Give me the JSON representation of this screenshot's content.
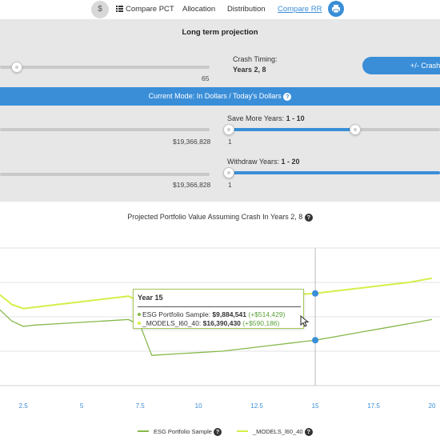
{
  "nav": {
    "dollar_icon": "$",
    "compare_pct": "Compare PCT",
    "allocation": "Allocation",
    "distribution": "Distribution",
    "compare_rr": "Compare RR"
  },
  "projection": {
    "title": "Long term projection",
    "slider_max_label": "65",
    "crash_timing_label": "Crash Timing:",
    "crash_timing_value": "Years 2, 8",
    "crash_button": "+/- Crash",
    "mode_text": "Current Mode: In Dollars / Today's Dollars",
    "save_more_label": "Save More Years:",
    "save_more_value": "1 - 10",
    "save_value": "$19,366,828",
    "save_min": "1",
    "withdraw_label": "Withdraw Years:",
    "withdraw_value": "1 - 20",
    "withdraw_amount": "$19,366,828",
    "withdraw_min": "1"
  },
  "colors": {
    "accent": "#3a8ed8",
    "series_esg": "#86b84a",
    "series_models": "#d6ee4a"
  },
  "chart_data": {
    "type": "line",
    "title": "Projected Portfolio Value Assuming Crash In Years 2, 8",
    "x_ticks": [
      "2.5",
      "5",
      "7.5",
      "10",
      "12.5",
      "15",
      "17.5",
      "20"
    ],
    "xlim": [
      1.5,
      20
    ],
    "ylim": [
      0,
      1
    ],
    "y_scale_note": "no y-axis labels visible",
    "crosshair_x": 15,
    "series": [
      {
        "name": "ESG Portfolio Sample",
        "x": [
          1.5,
          2,
          2.5,
          3,
          4,
          5,
          6,
          7,
          7.5,
          8,
          9,
          10,
          11,
          12,
          13,
          14,
          15,
          16,
          17,
          18,
          19,
          20
        ],
        "y": [
          0.55,
          0.47,
          0.43,
          0.44,
          0.45,
          0.46,
          0.47,
          0.48,
          0.44,
          0.22,
          0.23,
          0.24,
          0.25,
          0.27,
          0.29,
          0.31,
          0.33,
          0.36,
          0.39,
          0.42,
          0.45,
          0.48
        ]
      },
      {
        "name": "_MODELS_l60_40",
        "x": [
          1.5,
          2,
          2.5,
          3,
          4,
          5,
          6,
          7,
          7.5,
          8,
          9,
          10,
          11,
          12,
          13,
          14,
          15,
          16,
          17,
          18,
          19,
          20
        ],
        "y": [
          0.66,
          0.59,
          0.56,
          0.57,
          0.59,
          0.61,
          0.63,
          0.65,
          0.61,
          0.58,
          0.6,
          0.62,
          0.63,
          0.64,
          0.65,
          0.66,
          0.67,
          0.69,
          0.71,
          0.73,
          0.75,
          0.78
        ]
      }
    ],
    "tooltip": {
      "title": "Year 15",
      "esg_name": "ESG Portfolio Sample:",
      "esg_value": "$9,884,541",
      "esg_change": "(+$514,429)",
      "models_name": "_MODELS_l60_40:",
      "models_value": "$16,390,430",
      "models_change": "(+$590,186)"
    },
    "legend": {
      "esg": "ESG Portfolio Sample",
      "models": "_MODELS_l60_40"
    }
  }
}
